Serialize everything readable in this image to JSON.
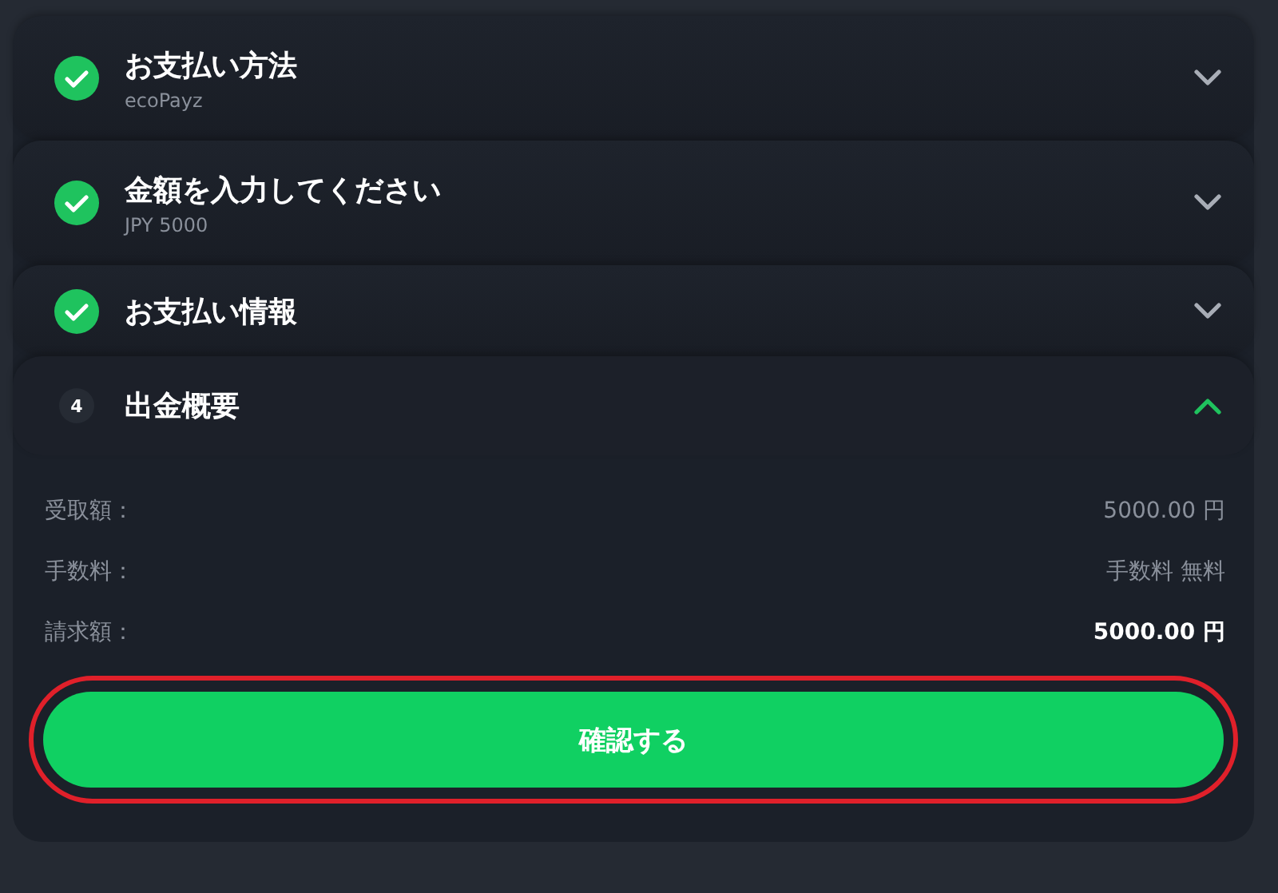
{
  "steps": [
    {
      "kind": "done",
      "title": "お支払い方法",
      "subtitle": "ecoPayz",
      "expanded": false
    },
    {
      "kind": "done",
      "title": "金額を入力してください",
      "subtitle": "JPY 5000",
      "expanded": false
    },
    {
      "kind": "done",
      "title": "お支払い情報",
      "expanded": false
    },
    {
      "kind": "number",
      "number": "4",
      "title": "出金概要",
      "expanded": true
    }
  ],
  "summary": [
    {
      "label": "受取額：",
      "value": "5000.00 円",
      "bold": false
    },
    {
      "label": "手数料：",
      "value": "手数料 無料",
      "bold": false
    },
    {
      "label": "請求額：",
      "value": "5000.00 円",
      "bold": true
    }
  ],
  "confirm_button": {
    "label": "確認する",
    "highlighted": true
  }
}
